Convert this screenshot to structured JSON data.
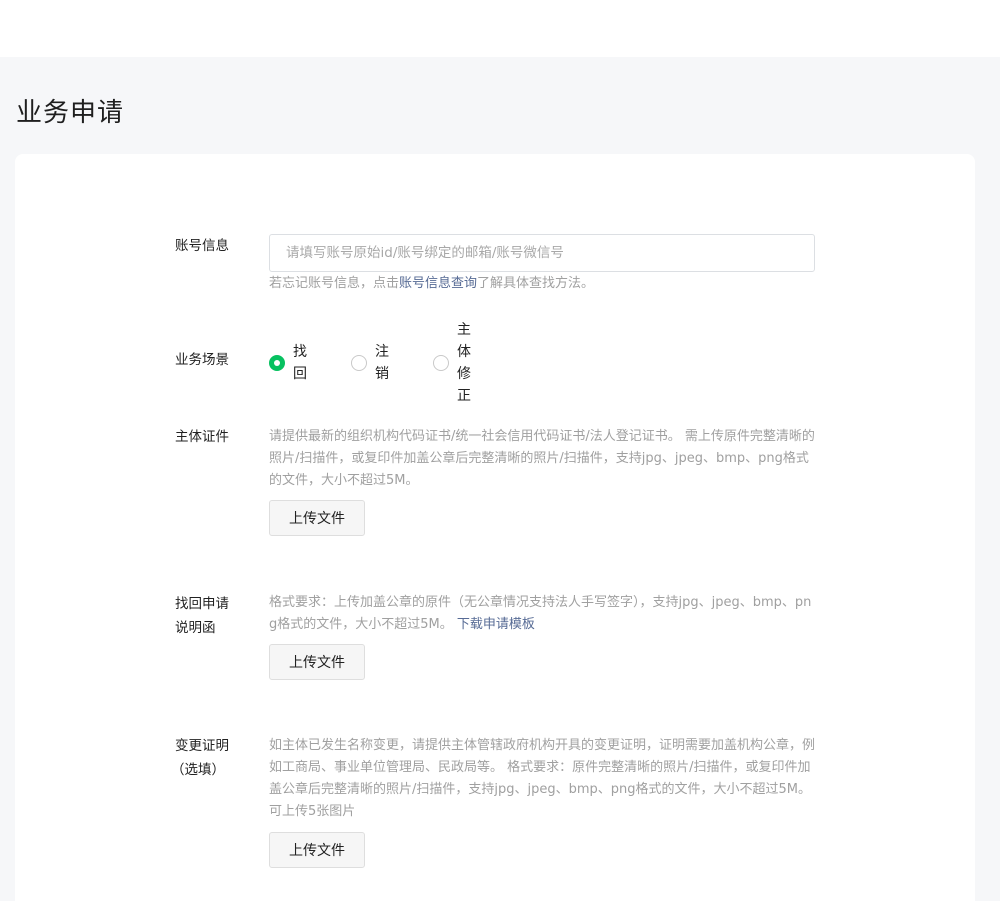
{
  "page": {
    "title": "业务申请",
    "colors": {
      "accent": "#07c160",
      "link": "#576b95",
      "hint": "#a0a0a0",
      "background": "#f6f7f9"
    }
  },
  "form": {
    "account": {
      "label": "账号信息",
      "placeholder": "请填写账号原始id/账号绑定的邮箱/账号微信号",
      "value": "",
      "hint_before": "若忘记账号信息，点击",
      "hint_link": "账号信息查询",
      "hint_after": "了解具体查找方法。"
    },
    "scene": {
      "label": "业务场景",
      "options": [
        {
          "label": "找回",
          "checked": true
        },
        {
          "label": "注销",
          "checked": false
        },
        {
          "label": "主体修正",
          "checked": false
        }
      ]
    },
    "entity_cert": {
      "label": "主体证件",
      "hint": "请提供最新的组织机构代码证书/统一社会信用代码证书/法人登记证书。 需上传原件完整清晰的照片/扫描件，或复印件加盖公章后完整清晰的照片/扫描件，支持jpg、jpeg、bmp、png格式的文件，大小不超过5M。",
      "upload_label": "上传文件"
    },
    "recovery_letter": {
      "label_line1": "找回申请",
      "label_line2": "说明函",
      "hint": "格式要求：上传加盖公章的原件（无公章情况支持法人手写签字），支持jpg、jpeg、bmp、png格式的文件，大小不超过5M。 ",
      "hint_link": "下载申请模板",
      "upload_label": "上传文件"
    },
    "change_proof": {
      "label_line1": "变更证明",
      "label_line2": "（选填）",
      "hint": "如主体已发生名称变更，请提供主体管辖政府机构开具的变更证明，证明需要加盖机构公章，例如工商局、事业单位管理局、民政局等。 格式要求：原件完整清晰的照片/扫描件，或复印件加盖公章后完整清晰的照片/扫描件，支持jpg、jpeg、bmp、png格式的文件，大小不超过5M。可上传5张图片",
      "upload_label": "上传文件"
    }
  }
}
